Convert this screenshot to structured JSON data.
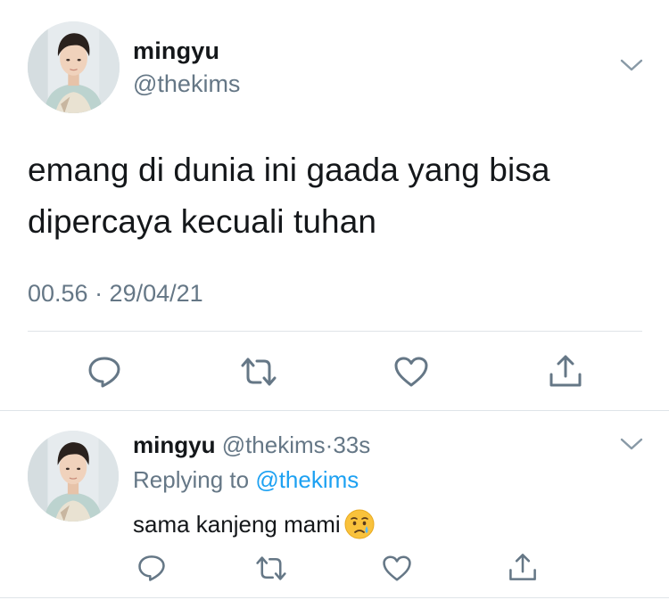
{
  "main_tweet": {
    "display_name": "mingyu",
    "handle": "@thekims",
    "text": "emang di dunia ini gaada yang bisa dipercaya kecuali tuhan",
    "timestamp": "00.56 · 29/04/21",
    "more_icon": "chevron-down-icon",
    "actions": [
      "reply-icon",
      "retweet-icon",
      "like-icon",
      "share-icon"
    ]
  },
  "reply_tweet": {
    "display_name": "mingyu",
    "handle": "@thekims",
    "separator": "·",
    "time_ago": "33s",
    "replying_prefix": "Replying to",
    "replying_handle": "@thekims",
    "text": "sama kanjeng mami",
    "emoji": "crying-face-emoji",
    "more_icon": "chevron-down-icon",
    "actions": [
      "reply-icon",
      "retweet-icon",
      "like-icon",
      "share-icon"
    ]
  },
  "colors": {
    "text_primary": "#14171a",
    "text_secondary": "#657786",
    "link": "#1da1f2",
    "divider": "#dfe4e8",
    "icon": "#657786"
  }
}
